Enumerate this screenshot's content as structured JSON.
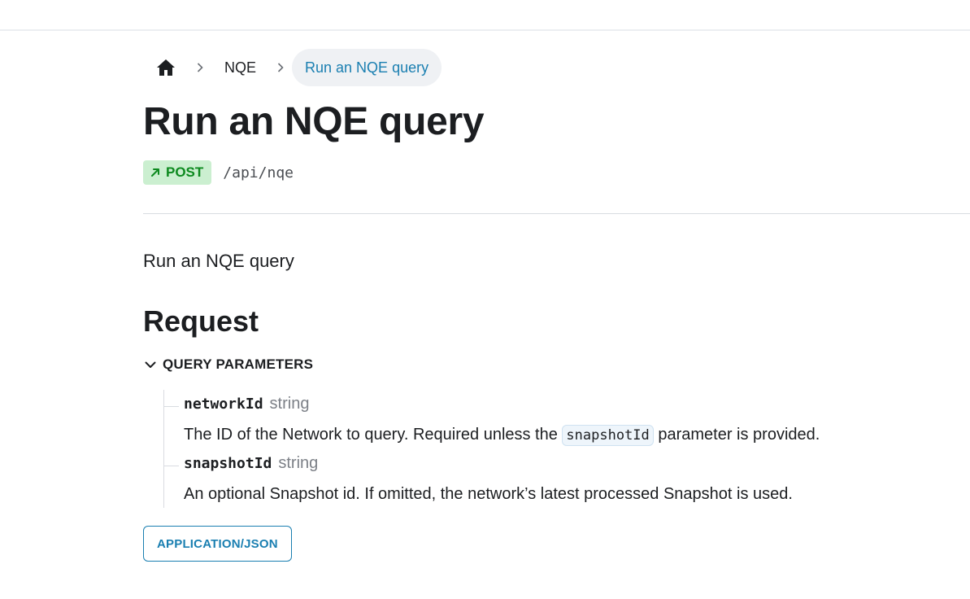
{
  "breadcrumbs": {
    "home_icon": "home-icon",
    "items": [
      {
        "label": "NQE"
      },
      {
        "label": "Run an NQE query"
      }
    ]
  },
  "page": {
    "title": "Run an NQE query",
    "method": "POST",
    "path": "/api/nqe",
    "description": "Run an NQE query"
  },
  "request": {
    "heading": "Request",
    "query_params_label": "QUERY PARAMETERS",
    "params": [
      {
        "name": "networkId",
        "type": "string",
        "desc_before": "The ID of the Network to query. Required unless the ",
        "desc_code": "snapshotId",
        "desc_after": " parameter is provided."
      },
      {
        "name": "snapshotId",
        "type": "string",
        "desc": "An optional Snapshot id. If omitted, the network’s latest processed Snapshot is used."
      }
    ],
    "mime_button": "APPLICATION/JSON"
  },
  "colors": {
    "accent": "#1a7fb1",
    "post_badge_bg": "#cbefd0",
    "post_badge_text": "#0d8a1f"
  }
}
